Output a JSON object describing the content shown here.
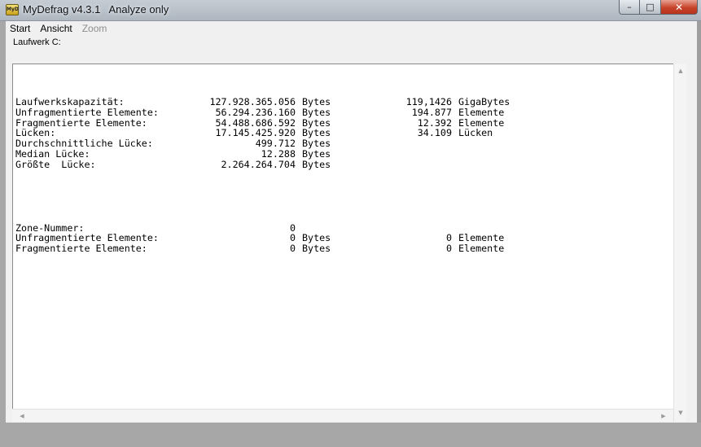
{
  "window": {
    "icon_text": "MyD",
    "title": "MyDefrag v4.3.1   Analyze only",
    "minimize": "–",
    "maximize": "□",
    "close": "✕"
  },
  "menu": {
    "items": [
      {
        "label": "Start",
        "enabled": true
      },
      {
        "label": "Ansicht",
        "enabled": true
      },
      {
        "label": "Zoom",
        "enabled": false
      }
    ]
  },
  "drive_label": "Laufwerk C:",
  "report": {
    "stats": [
      {
        "label": "Laufwerkskapazität:",
        "value": "127.928.365.056",
        "unit": "Bytes",
        "value2": "119,1426",
        "unit2": "GigaBytes"
      },
      {
        "label": "Unfragmentierte Elemente:",
        "value": "56.294.236.160",
        "unit": "Bytes",
        "value2": "194.877",
        "unit2": "Elemente"
      },
      {
        "label": "Fragmentierte Elemente:",
        "value": "54.488.686.592",
        "unit": "Bytes",
        "value2": "12.392",
        "unit2": "Elemente"
      },
      {
        "label": "Lücken:",
        "value": "17.145.425.920",
        "unit": "Bytes",
        "value2": "34.109",
        "unit2": "Lücken"
      },
      {
        "label": "Durchschnittliche Lücke:",
        "value": "499.712",
        "unit": "Bytes",
        "value2": "",
        "unit2": ""
      },
      {
        "label": "Median Lücke:",
        "value": "12.288",
        "unit": "Bytes",
        "value2": "",
        "unit2": ""
      },
      {
        "label": "Größte  Lücke:",
        "value": "2.264.264.704",
        "unit": "Bytes",
        "value2": "",
        "unit2": ""
      }
    ],
    "zone": [
      {
        "label": "Zone-Nummer:",
        "value": "0",
        "unit": "",
        "value2": "",
        "unit2": ""
      },
      {
        "label": "Unfragmentierte Elemente:",
        "value": "0",
        "unit": "Bytes",
        "value2": "0",
        "unit2": "Elemente"
      },
      {
        "label": "Fragmentierte Elemente:",
        "value": "0",
        "unit": "Bytes",
        "value2": "0",
        "unit2": "Elemente"
      }
    ]
  },
  "scrollbars": {
    "up": "▲",
    "down": "▼",
    "left": "◀",
    "right": "▶"
  }
}
